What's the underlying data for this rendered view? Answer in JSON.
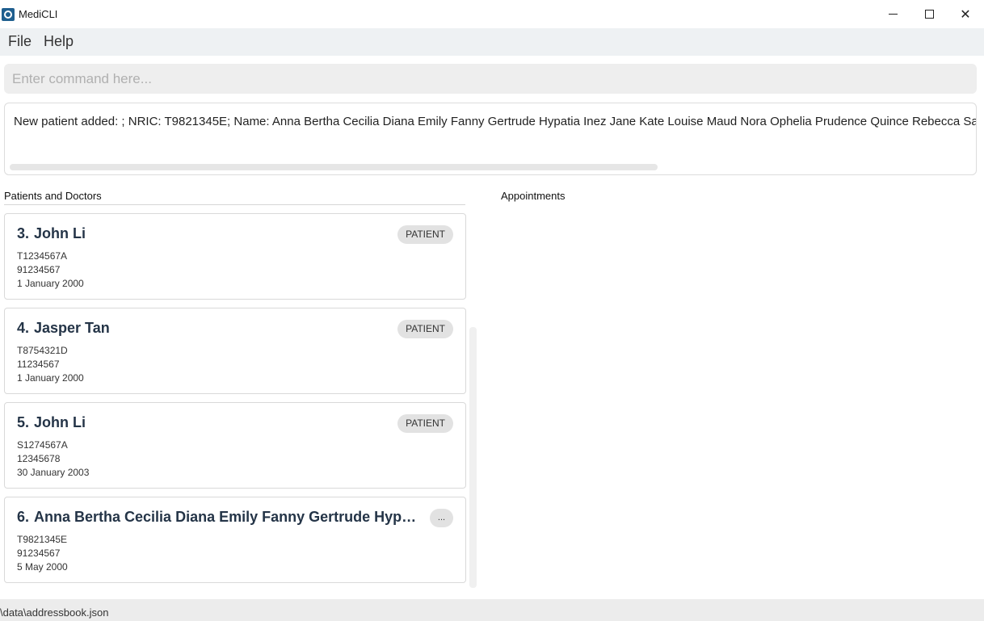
{
  "window": {
    "title": "MediCLI",
    "min_glyph": "",
    "close_glyph": "✕"
  },
  "menu": {
    "file": "File",
    "help": "Help"
  },
  "command": {
    "placeholder": "Enter command here...",
    "value": ""
  },
  "result": {
    "text": "New patient added: ; NRIC: T9821345E; Name: Anna Bertha Cecilia Diana Emily Fanny Gertrude Hypatia Inez Jane Kate Louise Maud Nora Ophelia Prudence Quince Rebecca Sarah Teresa"
  },
  "panels": {
    "people_label": "Patients and Doctors",
    "appointments_label": "Appointments"
  },
  "people": [
    {
      "index": "3.",
      "name": "John Li",
      "badge": "PATIENT",
      "nric": "T1234567A",
      "phone": "91234567",
      "dob": "1 January 2000"
    },
    {
      "index": "4.",
      "name": "Jasper Tan",
      "badge": "PATIENT",
      "nric": "T8754321D",
      "phone": "11234567",
      "dob": "1 January 2000"
    },
    {
      "index": "5.",
      "name": "John Li",
      "badge": "PATIENT",
      "nric": "S1274567A",
      "phone": "12345678",
      "dob": "30 January 2003"
    },
    {
      "index": "6.",
      "name": "Anna Bertha Cecilia Diana Emily Fanny Gertrude Hypatia Inez Jane Kate Louise Maud Nora Ophelia Prudence Quince Rebecca Sarah Teresa",
      "badge": "...",
      "nric": "T9821345E",
      "phone": "91234567",
      "dob": "5 May 2000"
    }
  ],
  "status": {
    "path": "\\data\\addressbook.json"
  }
}
